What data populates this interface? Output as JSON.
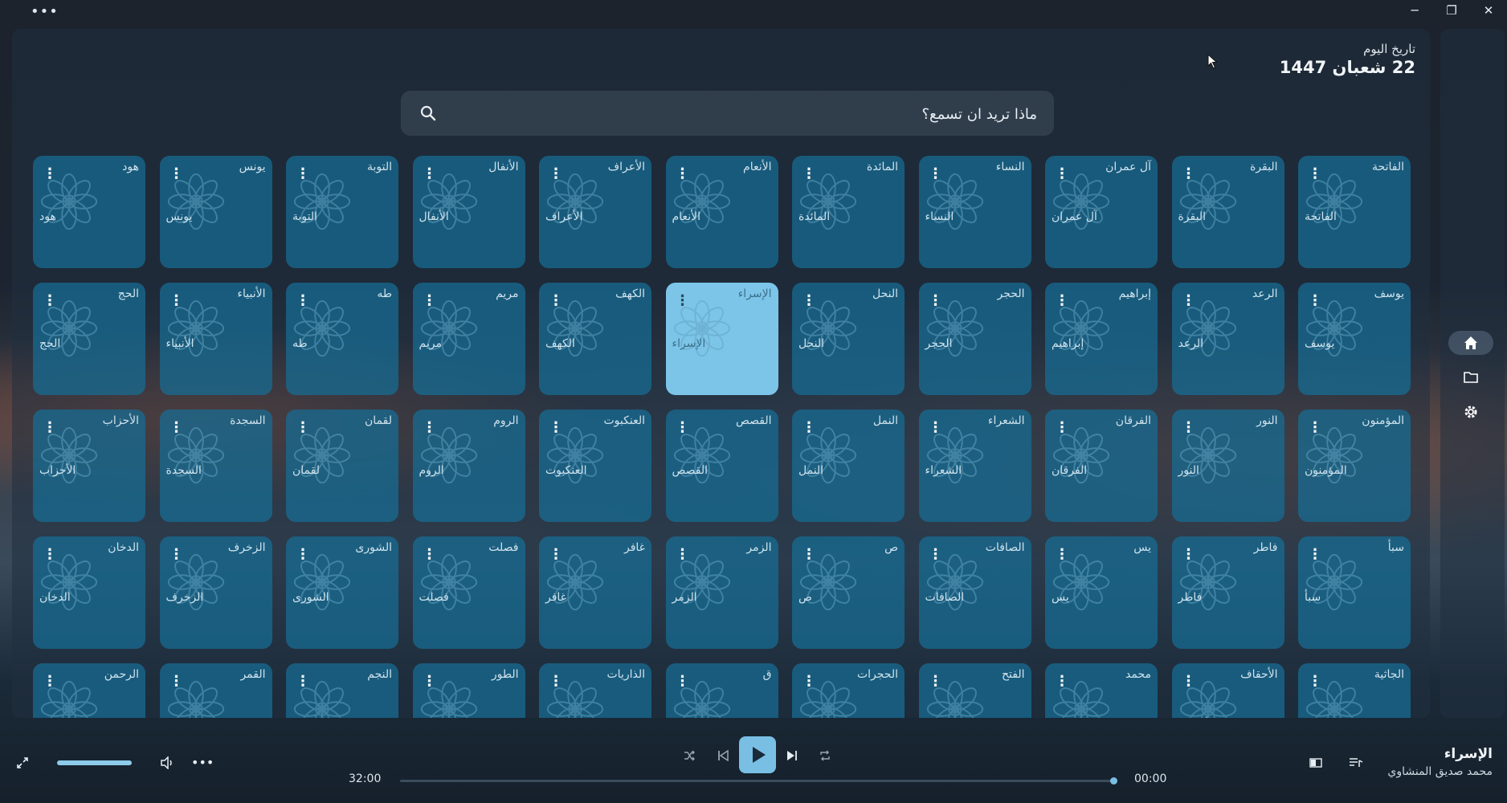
{
  "titlebar": {
    "menu_label": "•••",
    "minimize_label": "─",
    "maximize_label": "❐",
    "close_label": "✕"
  },
  "header": {
    "date_label": "تاريخ اليوم",
    "date_value": "22 شعبان 1447"
  },
  "search": {
    "placeholder": "ماذا تريد ان تسمع؟"
  },
  "grid": {
    "menu_label": "⋮",
    "active_index": 16,
    "surahs": [
      "الفاتحة",
      "البقرة",
      "آل عمران",
      "النساء",
      "المائدة",
      "الأنعام",
      "الأعراف",
      "الأنفال",
      "التوبة",
      "يونس",
      "هود",
      "يوسف",
      "الرعد",
      "إبراهيم",
      "الحجر",
      "النحل",
      "الإسراء",
      "الكهف",
      "مريم",
      "طه",
      "الأنبياء",
      "الحج",
      "المؤمنون",
      "النور",
      "الفرقان",
      "الشعراء",
      "النمل",
      "القصص",
      "العنكبوت",
      "الروم",
      "لقمان",
      "السجدة",
      "الأحزاب",
      "سبأ",
      "فاطر",
      "يس",
      "الصافات",
      "ص",
      "الزمر",
      "غافر",
      "فصلت",
      "الشورى",
      "الزخرف",
      "الدخان",
      "الجاثية",
      "الأحقاف",
      "محمد",
      "الفتح",
      "الحجرات",
      "ق",
      "الذاريات",
      "الطور",
      "النجم",
      "القمر",
      "الرحمن"
    ]
  },
  "rail": {
    "items": [
      "home-icon",
      "folder-icon",
      "gear-icon"
    ]
  },
  "player": {
    "now_title": "الإسراء",
    "now_artist": "محمد صديق المنشاوي",
    "time_elapsed": "00:00",
    "time_total": "32:00",
    "progress_fraction": 0,
    "volume_fraction": 1.0,
    "more_label": "•••"
  },
  "colors": {
    "accent": "#79bfe3",
    "tile": "#166e96",
    "tile_active": "#7cc5e9"
  }
}
